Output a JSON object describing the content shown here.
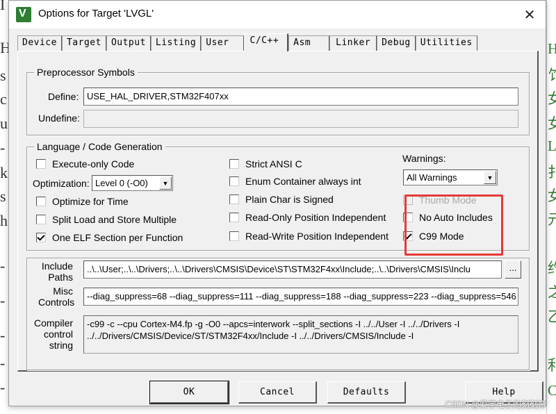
{
  "window": {
    "title": "Options for Target 'LVGL'",
    "app_icon": "V",
    "close_label": "✕"
  },
  "tabs": [
    "Device",
    "Target",
    "Output",
    "Listing",
    "User",
    "C/C++",
    "Asm",
    "Linker",
    "Debug",
    "Utilities"
  ],
  "active_tab": "C/C++",
  "preprocessor": {
    "legend": "Preprocessor Symbols",
    "define_label": "Define:",
    "define_value": "USE_HAL_DRIVER,STM32F407xx",
    "undefine_label": "Undefine:",
    "undefine_value": ""
  },
  "language": {
    "legend": "Language / Code Generation",
    "execute_only": {
      "label": "Execute-only Code",
      "checked": false
    },
    "optimization_label": "Optimization:",
    "optimization_value": "Level 0 (-O0)",
    "optimize_time": {
      "label": "Optimize for Time",
      "checked": false
    },
    "split_load": {
      "label": "Split Load and Store Multiple",
      "checked": false
    },
    "one_elf": {
      "label": "One ELF Section per Function",
      "checked": true
    },
    "strict_ansi": {
      "label": "Strict ANSI C",
      "checked": false
    },
    "enum_container": {
      "label": "Enum Container always int",
      "checked": false
    },
    "plain_char": {
      "label": "Plain Char is Signed",
      "checked": false
    },
    "ro_pi": {
      "label": "Read-Only Position Independent",
      "checked": false
    },
    "rw_pi": {
      "label": "Read-Write Position Independent",
      "checked": false
    },
    "warnings_label": "Warnings:",
    "warnings_value": "All Warnings",
    "thumb_mode": {
      "label": "Thumb Mode",
      "checked": false,
      "disabled": true
    },
    "no_auto_includes": {
      "label": "No Auto Includes",
      "checked": false
    },
    "c99_mode": {
      "label": "C99 Mode",
      "checked": true
    }
  },
  "paths": {
    "include_label_1": "Include",
    "include_label_2": "Paths",
    "include_value": "..\\..\\User;..\\..\\Drivers;..\\..\\Drivers\\CMSIS\\Device\\ST\\STM32F4xx\\Include;..\\..\\Drivers\\CMSIS\\Inclu",
    "browse_label": "...",
    "misc_label_1": "Misc",
    "misc_label_2": "Controls",
    "misc_value": "--diag_suppress=68 --diag_suppress=111 --diag_suppress=188 --diag_suppress=223 --diag_suppress=546",
    "compiler_label_1": "Compiler",
    "compiler_label_2": "control",
    "compiler_label_3": "string",
    "compiler_line_1": "-c99 -c --cpu Cortex-M4.fp -g -O0 --apcs=interwork --split_sections -I ../../User -I ../../Drivers -I",
    "compiler_line_2": "../../Drivers/CMSIS/Device/ST/STM32F4xx/Include -I ../../Drivers/CMSIS/Include -I"
  },
  "buttons": {
    "ok": "OK",
    "cancel": "Cancel",
    "defaults": "Defaults",
    "help": "Help"
  },
  "watermark": "CSDN @爱学电子的刻刻帝",
  "background_left_glyphs": [
    "I",
    "H",
    "s",
    "c",
    "u",
    "-",
    "k",
    "s",
    "h",
    "-",
    "-",
    "-",
    "-",
    "-"
  ],
  "background_right_glyphs": [
    "H",
    "饣",
    "女",
    "女",
    "L",
    "扌",
    "女",
    "元",
    "约",
    "之",
    "乙",
    "利",
    "C"
  ],
  "colors": {
    "highlight": "#e53935",
    "dialog_bg": "#f0f0f0",
    "app_icon": "#2e7d32"
  }
}
